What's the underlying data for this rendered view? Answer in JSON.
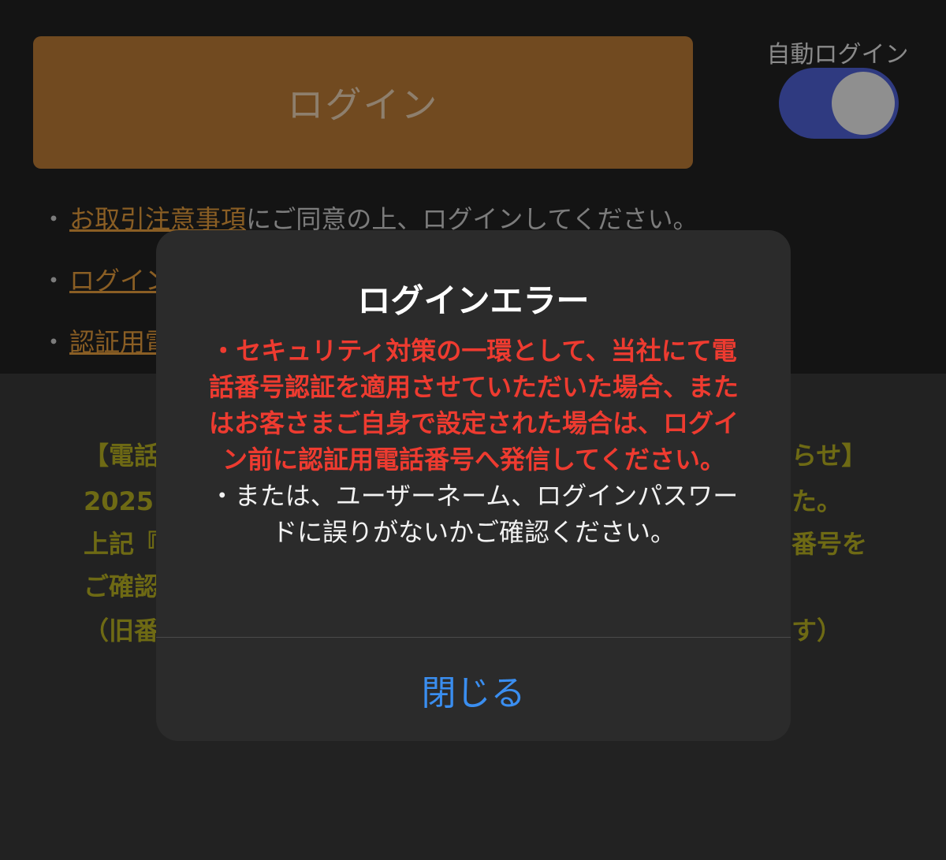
{
  "login": {
    "button_label": "ログイン",
    "auto_login_label": "自動ログイン",
    "auto_login_on": true
  },
  "notes": [
    {
      "bullet": "・",
      "link": "お取引注意事項",
      "text": "にご同意の上、ログインしてください。"
    },
    {
      "bullet": "・",
      "link": "ログイン",
      "text": ""
    },
    {
      "bullet": "・",
      "link": "認証用電",
      "text": ""
    }
  ],
  "notice": {
    "line1_left": "【電話",
    "line1_right": "らせ】",
    "line2_left": "2025",
    "line2_right": "た。",
    "line3_left": "上記『",
    "line3_right": "番号を",
    "line4_left": "ご確認",
    "line5_left": "（旧番",
    "line5_right": "す）"
  },
  "dialog": {
    "title": "ログインエラー",
    "message_red": "・セキュリティ対策の一環として、当社にて電話番号認証を適用させていただいた場合、またはお客さまご自身で設定された場合は、ログイン前に認証用電話番号へ発信してください。",
    "message_white": "・または、ユーザーネーム、ログインパスワードに誤りがないかご確認ください。",
    "close_label": "閉じる"
  },
  "colors": {
    "accent_blue": "#3a8ef0",
    "error_red": "#ee3b30",
    "login_button": "#714a20"
  }
}
